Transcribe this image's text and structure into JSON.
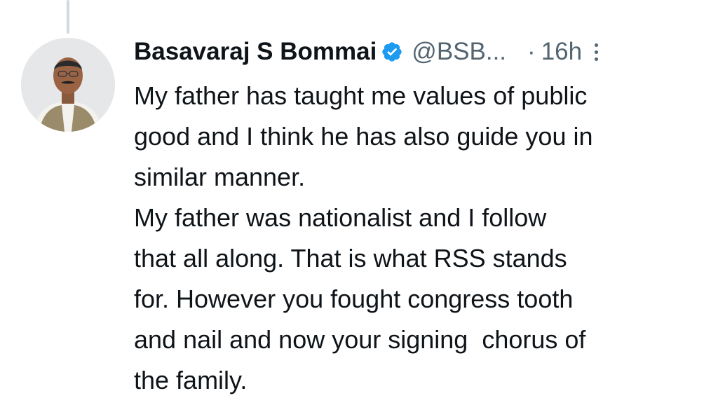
{
  "tweet": {
    "author_name": "Basavaraj S Bommai",
    "handle": "@BSB...",
    "separator": "·",
    "time": "16h",
    "verified_icon": "verified-badge-icon",
    "more_icon": "more-options-icon",
    "accent_color": "#1d9bf0",
    "text_lines": [
      "My father has taught me values of public",
      "good and I think he has also guide you in",
      "similar manner.",
      "My father was nationalist and I follow",
      "that all along. That is what RSS stands",
      "for. However you fought congress tooth",
      "and nail and now your signing  chorus of",
      "the family."
    ]
  }
}
